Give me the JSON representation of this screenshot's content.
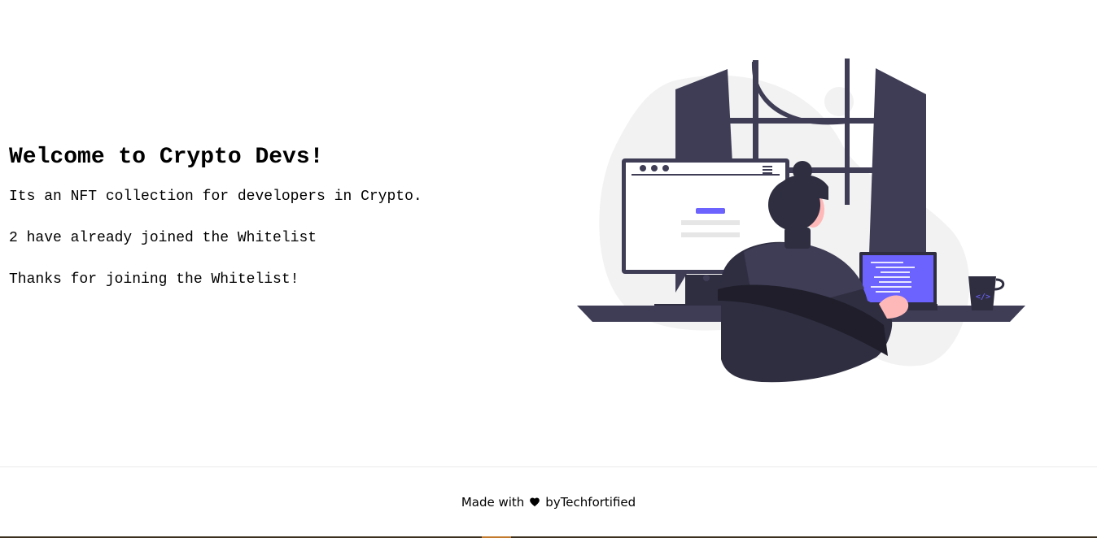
{
  "intro": {
    "title": "Welcome to Crypto Devs!",
    "description": "Its an NFT collection for developers in Crypto.",
    "joined_status": "2 have already joined the Whitelist",
    "thanks_message": "Thanks for joining the Whitelist!"
  },
  "illustration": {
    "name": "developer-at-desk-illustration",
    "accent_color": "#6c63ff",
    "dark_color": "#3f3d56"
  },
  "footer": {
    "made_with": "Made with",
    "heart_icon": "heart-icon",
    "by_text": "byTechfortified"
  }
}
